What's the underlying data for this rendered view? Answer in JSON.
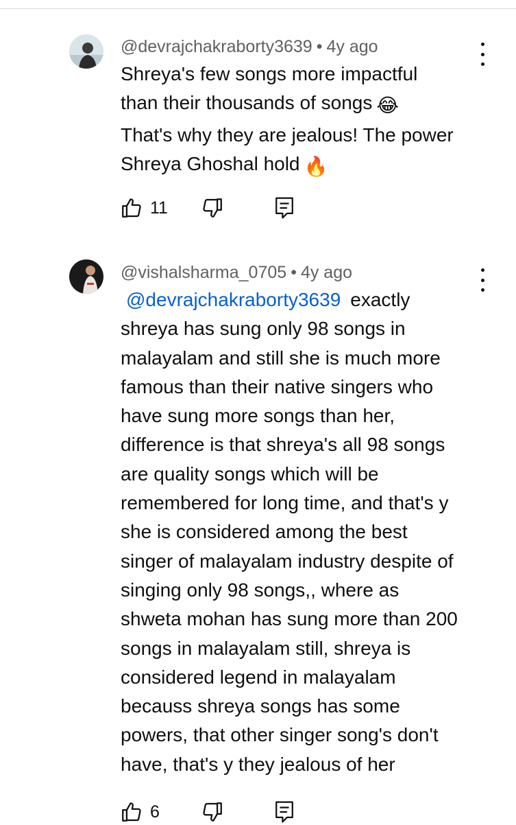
{
  "comments": [
    {
      "author": "@devrajchakraborty3639",
      "time": "4y ago",
      "lines": [
        "Shreya's few songs more impactful",
        "than their thousands of songs",
        "That's why they are jealous! The power",
        "Shreya Ghoshal hold"
      ],
      "emojis": [
        "😂",
        "🔥"
      ],
      "likes": "11",
      "icons": [
        "like-icon",
        "dislike-icon",
        "reply-icon",
        "more-vert-icon"
      ]
    },
    {
      "author": "@vishalsharma_0705",
      "time": "4y ago",
      "mention": "@devrajchakraborty3639",
      "first_line_rest": "exactly",
      "lines": [
        "shreya has sung only 98 songs in",
        "malayalam and still she is much more",
        "famous than their native singers who",
        "have sung more songs than her,",
        "difference is that shreya's all 98 songs",
        "are quality songs which will be",
        "remembered for long time, and that's y",
        "she is considered among the best",
        "singer of malayalam industry despite of",
        "singing only 98 songs,, where as",
        "shweta mohan has sung more than 200",
        "songs in malayalam still, shreya is",
        "considered legend in malayalam",
        "becauss shreya songs has some",
        "powers, that other singer song's don't",
        "have, that's y they jealous of her"
      ],
      "likes": "6",
      "icons": [
        "like-icon",
        "dislike-icon",
        "reply-icon",
        "more-vert-icon"
      ]
    }
  ],
  "colors": {
    "text": "#0f0f0f",
    "meta": "#606060",
    "mention": "#065fd4"
  }
}
